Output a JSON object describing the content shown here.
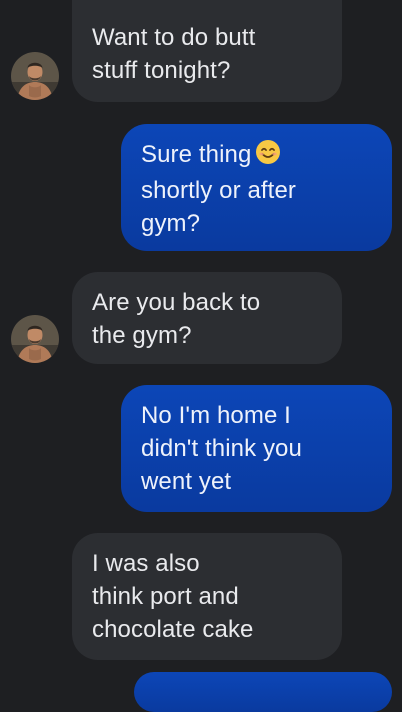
{
  "conversation": {
    "messages": [
      {
        "direction": "incoming",
        "lines": [
          "Want to do butt",
          "stuff tonight?"
        ],
        "avatar_icon": "contact-avatar-icon"
      },
      {
        "direction": "outgoing",
        "lines": [
          "Sure thing",
          "shortly or after",
          "gym?"
        ],
        "emoji_icon": "smiling-face-emoji-icon"
      },
      {
        "direction": "incoming",
        "lines": [
          "Are you back to",
          "the gym?"
        ],
        "avatar_icon": "contact-avatar-icon"
      },
      {
        "direction": "outgoing",
        "lines": [
          "No I'm home I",
          "didn't think you",
          "went yet"
        ]
      },
      {
        "direction": "incoming",
        "lines": [
          "I was also",
          "think port and",
          "chocolate cake"
        ]
      }
    ]
  },
  "colors": {
    "background": "#1e1f22",
    "incoming_bubble": "#2c2e32",
    "outgoing_bubble": "#0b3fa8",
    "incoming_text": "#e9eaed",
    "outgoing_text": "#eef2fb"
  }
}
